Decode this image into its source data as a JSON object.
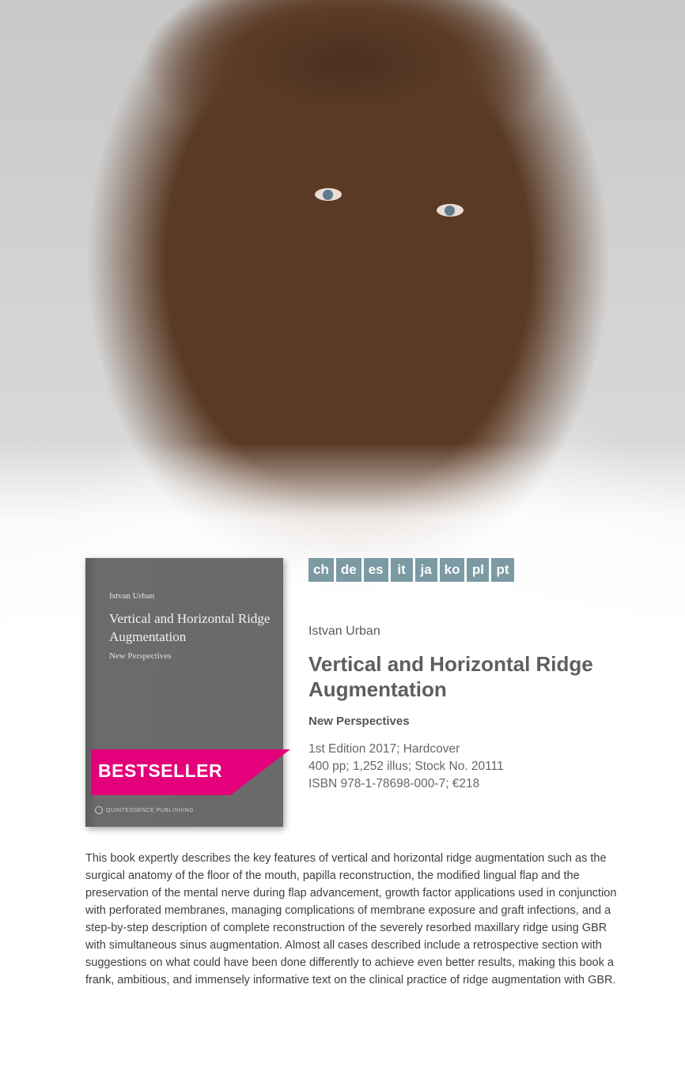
{
  "languages": [
    "ch",
    "de",
    "es",
    "it",
    "ja",
    "ko",
    "pl",
    "pt"
  ],
  "book_cover": {
    "author": "Istvan Urban",
    "title": "Vertical and Horizontal Ridge Augmentation",
    "subtitle": "New Perspectives",
    "publisher": "QUINTESSENCE PUBLISHING"
  },
  "badge": "BESTSELLER",
  "product": {
    "author": "Istvan Urban",
    "title": "Vertical and Horizontal Ridge Augmentation",
    "subtitle": "New Perspectives",
    "edition": "1st Edition 2017; Hardcover",
    "specs": "400 pp; 1,252 illus; Stock No. 20111",
    "isbn_price": "ISBN 978-1-78698-000-7; €218"
  },
  "description": "This book expertly describes the key features of vertical and horizontal ridge augmentation such as the surgical anatomy of the floor of the mouth, papilla reconstruction, the modified lingual flap and the preservation of the mental nerve during flap advancement, growth factor applications used in conjunction with perforated membranes, managing complications of membrane exposure and graft infections, and a step-by-step description of complete reconstruction of the severely resorbed maxillary ridge using GBR with simultaneous sinus augmentation. Almost all cases described include a retrospective section with suggestions on what could have been done differently to achieve even better results, making this book a frank, ambitious, and immensely informative text on the clinical practice of ridge augmentation with GBR.",
  "colors": {
    "accent": "#e4007a",
    "lang_bg": "#7c9aa3",
    "title": "#5e5e5e"
  }
}
